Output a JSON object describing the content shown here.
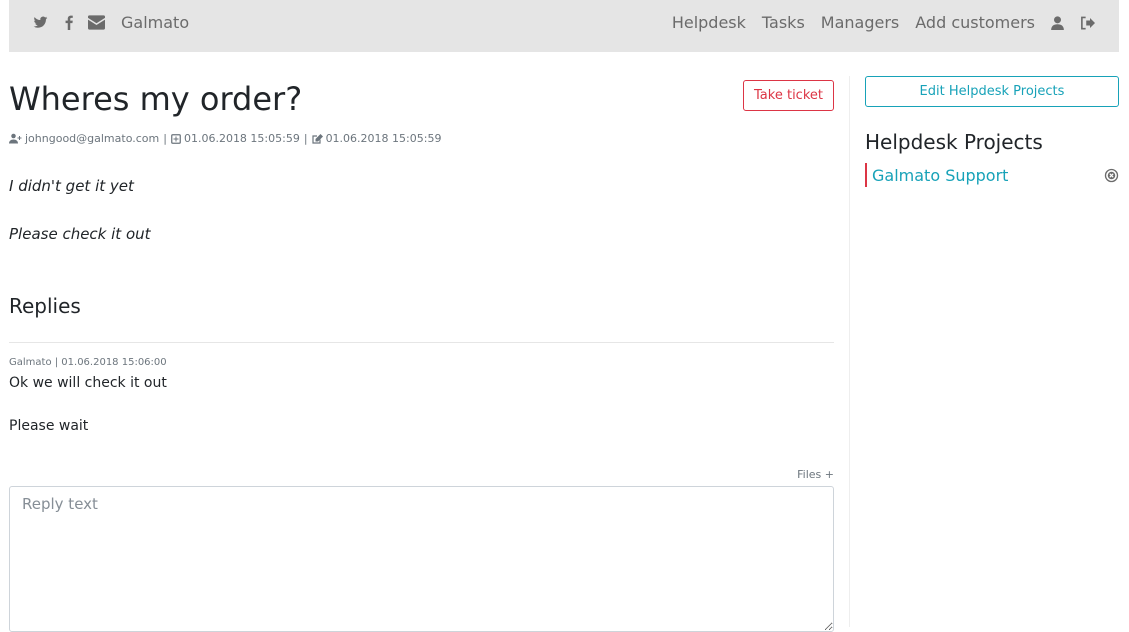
{
  "navbar": {
    "brand": "Galmato",
    "icons": [
      "twitter-icon",
      "facebook-icon",
      "envelope-icon"
    ],
    "links": [
      "Helpdesk",
      "Tasks",
      "Managers",
      "Add customers"
    ],
    "right_icons": [
      "user-icon",
      "sign-out-icon"
    ]
  },
  "ticket": {
    "title": "Wheres my order?",
    "take_label": "Take ticket",
    "email": "johngood@galmato.com",
    "created": "01.06.2018 15:05:59",
    "edited": "01.06.2018 15:05:59",
    "separator": "|",
    "body": [
      "I didn't get it yet",
      "Please check it out"
    ]
  },
  "replies": {
    "title": "Replies",
    "items": [
      {
        "meta": "Galmato | 01.06.2018 15:06:00",
        "lines": [
          "Ok we will check it out",
          "Please wait"
        ]
      }
    ],
    "files_label": "Files +",
    "reply_placeholder": "Reply text"
  },
  "sidebar": {
    "edit_label": "Edit Helpdesk Projects",
    "title": "Helpdesk Projects",
    "projects": [
      {
        "name": "Galmato Support"
      }
    ]
  },
  "colors": {
    "accent": "#17a2b8",
    "danger": "#dc3545",
    "navbar_bg": "#e5e5e5",
    "muted": "#6b6b6b"
  }
}
